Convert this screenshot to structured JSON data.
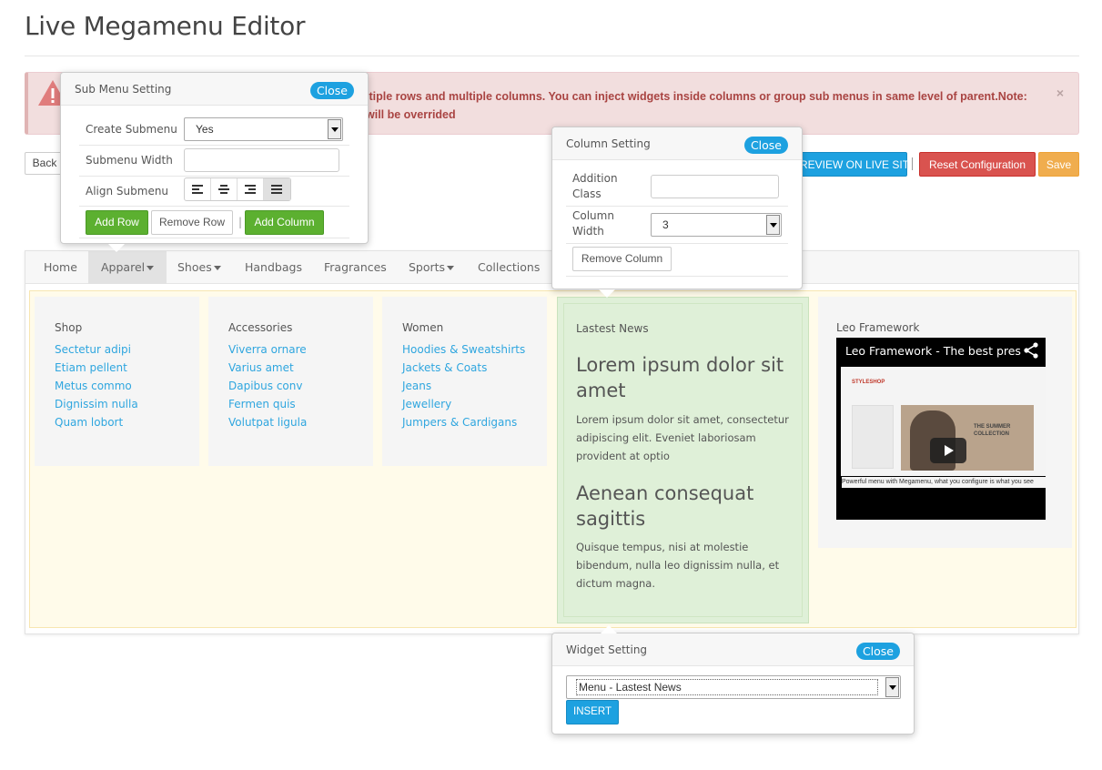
{
  "page": {
    "title": "Live Megamenu Editor"
  },
  "alert": {
    "line1": "ltiple rows and multiple columns. You can inject widgets inside columns or group sub menus in same level of parent.Note:",
    "line2": "will be overrided",
    "close": "×",
    "status_color": "#a94442"
  },
  "toolbar": {
    "back_label": "Back",
    "preview_label": "REVIEW ON LIVE SITE",
    "separator": "|",
    "reset_label": "Reset Configuration",
    "save_label": "Save"
  },
  "nav": {
    "items": [
      {
        "label": "Home",
        "dropdown": false
      },
      {
        "label": "Apparel",
        "dropdown": true,
        "active": true
      },
      {
        "label": "Shoes",
        "dropdown": true
      },
      {
        "label": "Handbags",
        "dropdown": false
      },
      {
        "label": "Fragrances",
        "dropdown": false
      },
      {
        "label": "Sports",
        "dropdown": true
      },
      {
        "label": "Collections",
        "dropdown": false
      }
    ]
  },
  "columns": [
    {
      "title": "Shop",
      "links": [
        "Sectetur adipi",
        "Etiam pellent",
        "Metus commo",
        "Dignissim nulla",
        "Quam lobort"
      ]
    },
    {
      "title": "Accessories",
      "links": [
        "Viverra ornare",
        "Varius amet",
        "Dapibus conv",
        "Fermen quis",
        "Volutpat ligula"
      ]
    },
    {
      "title": "Women",
      "links": [
        "Hoodies & Sweatshirts",
        "Jackets & Coats",
        "Jeans",
        "Jewellery",
        "Jumpers & Cardigans"
      ]
    }
  ],
  "news": {
    "title": "Lastest News",
    "heading1": "Lorem ipsum dolor sit amet",
    "text1": "Lorem ipsum dolor sit amet, consectetur adipiscing elit. Eveniet laboriosam provident at optio",
    "heading2": "Aenean consequat sagittis",
    "text2": "Quisque tempus, nisi at molestie bibendum, nulla leo dignissim nulla, et dictum magna."
  },
  "video": {
    "title": "Leo Framework",
    "video_title": "Leo Framework - The best pres",
    "shot_logo": "STYLESHOP",
    "shot_text": "THE SUMMER COLLECTION",
    "caption": "Powerful menu with Megamenu, what you configure is what you see"
  },
  "submenu_panel": {
    "title": "Sub Menu Setting",
    "close": "Close",
    "create_label": "Create Submenu",
    "create_value": "Yes",
    "width_label": "Submenu Width",
    "width_value": "",
    "align_label": "Align Submenu",
    "add_row": "Add Row",
    "remove_row": "Remove Row",
    "separator": "|",
    "add_column": "Add Column"
  },
  "column_panel": {
    "title": "Column Setting",
    "close": "Close",
    "class_label": "Addition Class",
    "class_value": "",
    "width_label": "Column Width",
    "width_value": "3",
    "remove_column": "Remove Column"
  },
  "widget_panel": {
    "title": "Widget Setting",
    "close": "Close",
    "select_value": "Menu - Lastest News",
    "insert": "INSERT"
  },
  "colors": {
    "accent": "#1da1e0",
    "success": "#5cb030",
    "danger": "#d9534f",
    "warning": "#f0ad4e",
    "link": "#2fa6df"
  }
}
